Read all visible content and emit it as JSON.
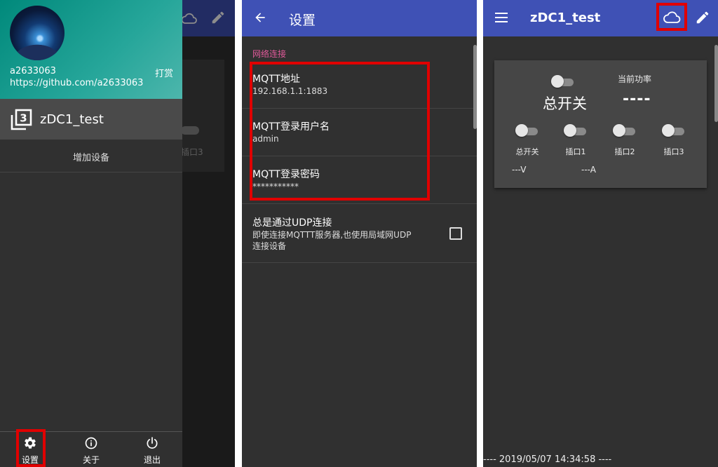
{
  "drawer": {
    "background_title": "zDC1_test",
    "background_label": "插口3",
    "header": {
      "username": "a2633063",
      "url": "https://github.com/a2633063",
      "tip_label": "打赏",
      "avatar_icon": "avatar-image",
      "color": "#26a69a"
    },
    "device_item": {
      "label": "zDC1_test",
      "icon": "filter-3-icon"
    },
    "add_device_label": "增加设备",
    "bottom": [
      {
        "label": "设置",
        "icon": "gear-icon"
      },
      {
        "label": "关于",
        "icon": "info-icon"
      },
      {
        "label": "退出",
        "icon": "power-icon"
      }
    ]
  },
  "settings": {
    "title": "设置",
    "back_icon": "arrow-back-icon",
    "section_header": "网络连接",
    "section_color": "#e05a9a",
    "items": [
      {
        "title": "MQTT地址",
        "summary": "192.168.1.1:1883"
      },
      {
        "title": "MQTT登录用户名",
        "summary": "admin"
      },
      {
        "title": "MQTT登录密码",
        "summary": "***********"
      }
    ],
    "udp": {
      "title": "总是通过UDP连接",
      "summary": "即使连接MQTTT服务器,也使用局域网UDP连接设备",
      "checked": false
    }
  },
  "device": {
    "title": "zDC1_test",
    "menu_icon": "menu-icon",
    "cloud_icon": "cloud-icon",
    "edit_icon": "pencil-icon",
    "power_label": "当前功率",
    "power_value": "----",
    "main_switch_label": "总开关",
    "switches": [
      {
        "label": "总开关",
        "on": false
      },
      {
        "label": "插口1",
        "on": false
      },
      {
        "label": "插口2",
        "on": false
      },
      {
        "label": "插口3",
        "on": false
      }
    ],
    "voltage": "---V",
    "current": "---A",
    "footer": "---- 2019/05/07 14:34:58 ----"
  },
  "colors": {
    "toolbar": "#3f51b5",
    "background": "#303030",
    "card": "#464646",
    "highlight": "#e00000"
  }
}
